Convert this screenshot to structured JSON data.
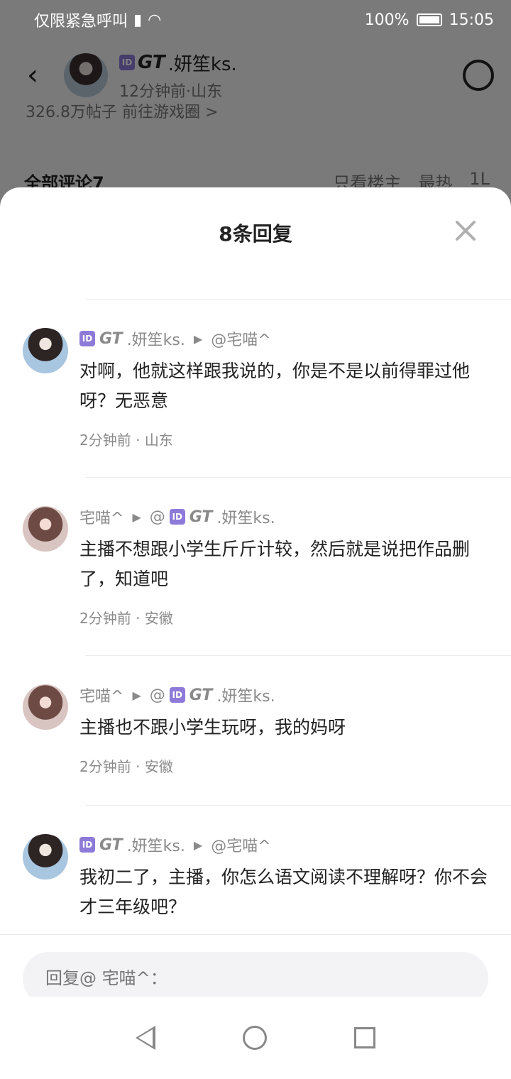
{
  "status_bar": {
    "carrier": "仅限紧急呼叫",
    "battery": "100%",
    "time": "15:05"
  },
  "post_header": {
    "author_name": "GT.妍笙ks.",
    "author_name_prefix": "GT",
    "author_name_suffix": ".妍笙ks.",
    "meta": "12分钟前·山东"
  },
  "background": {
    "strip_text": "326.8万帖子  前往游戏圈 >",
    "section_title": "全部评论7",
    "filter_label": "只看楼主",
    "sort_label": "最热",
    "floor_label": "1L"
  },
  "sheet": {
    "title": "8条回复"
  },
  "replies": [
    {
      "from_prefix": "GT",
      "from_suffix": ".妍笙ks.",
      "to": "@宅喵^",
      "text": "对啊，他就这样跟我说的，你是不是以前得罪过他呀？无恶意",
      "time": "2分钟前",
      "location": "山东"
    },
    {
      "from": "宅喵^",
      "to_prefix": "@",
      "to_gt": "GT",
      "to_suffix": ".妍笙ks.",
      "text": "主播不想跟小学生斤斤计较，然后就是说把作品删了，知道吧",
      "time": "2分钟前",
      "location": "安徽"
    },
    {
      "from": "宅喵^",
      "to_prefix": "@",
      "to_gt": "GT",
      "to_suffix": ".妍笙ks.",
      "text": "主播也不跟小学生玩呀，我的妈呀",
      "time": "2分钟前",
      "location": "安徽"
    },
    {
      "from_prefix": "GT",
      "from_suffix": ".妍笙ks.",
      "to": "@宅喵^",
      "text": "我初二了，主播，你怎么语文阅读不理解呀？你不会才三年级吧？",
      "time": "",
      "location": ""
    }
  ],
  "input": {
    "placeholder": "回复@ 宅喵^："
  },
  "colors": {
    "id_badge": "#8e7ad8",
    "meta_gray": "#8a8a8a"
  }
}
